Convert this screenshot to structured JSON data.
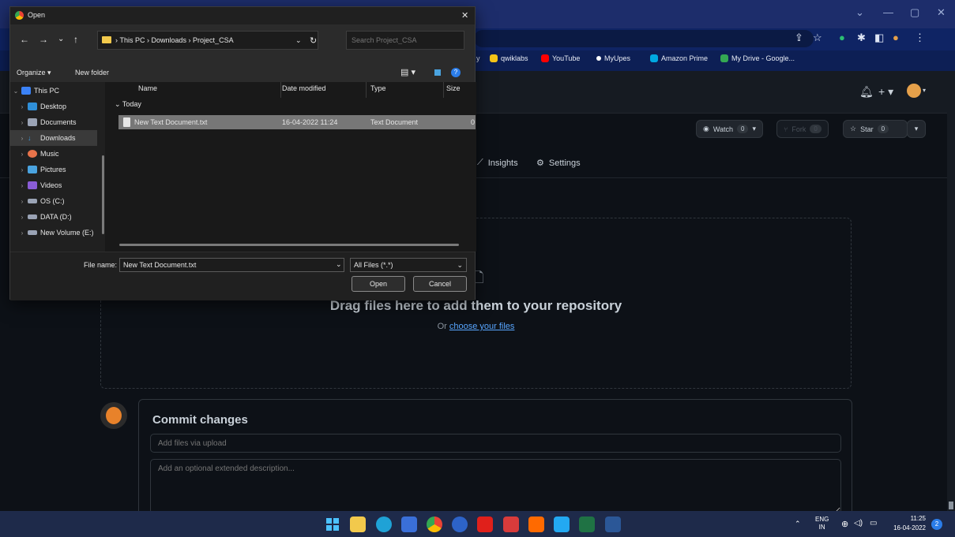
{
  "dialog": {
    "title": "Open",
    "close": "✕",
    "breadcrumb": [
      "This PC",
      "Downloads",
      "Project_CSA"
    ],
    "search_placeholder": "Search Project_CSA",
    "organize": "Organize ▾",
    "new_folder": "New folder",
    "nav_items": [
      {
        "label": "This PC",
        "color": "#3b82f6",
        "expanded": true
      },
      {
        "label": "Desktop",
        "color": "#2f8fd8"
      },
      {
        "label": "Documents",
        "color": "#9aa3b5"
      },
      {
        "label": "Downloads",
        "color": "#3b9ae1"
      },
      {
        "label": "Music",
        "color": "#e8734a"
      },
      {
        "label": "Pictures",
        "color": "#4aa3df"
      },
      {
        "label": "Videos",
        "color": "#8a5cd6"
      },
      {
        "label": "OS (C:)",
        "color": "#9aa3b5"
      },
      {
        "label": "DATA (D:)",
        "color": "#9aa3b5"
      },
      {
        "label": "New Volume (E:)",
        "color": "#9aa3b5"
      }
    ],
    "columns": {
      "name": "Name",
      "date": "Date modified",
      "type": "Type",
      "size": "Size"
    },
    "group": "Today",
    "file": {
      "name": "New Text Document.txt",
      "date": "16-04-2022 11:24",
      "type": "Text Document",
      "size": "0"
    },
    "file_name_label": "File name:",
    "file_name_value": "New Text Document.txt",
    "file_type": "All Files (*.*)",
    "open_button": "Open",
    "cancel_button": "Cancel"
  },
  "bookmarks": [
    {
      "label": "y",
      "color": "#000000"
    },
    {
      "label": "qwiklabs",
      "color": "#f5c518"
    },
    {
      "label": "YouTube",
      "color": "#ff0000"
    },
    {
      "label": "MyUpes",
      "color": "#ffffff"
    },
    {
      "label": "Amazon Prime",
      "color": "#00a8e1"
    },
    {
      "label": "My Drive - Google...",
      "color": "#34a853"
    }
  ],
  "repo": {
    "watch": "Watch",
    "watch_count": "0",
    "fork": "Fork",
    "fork_count": "0",
    "star": "Star",
    "star_count": "0",
    "tab_insights": "Insights",
    "tab_settings": "Settings"
  },
  "upload": {
    "drop_title": "Drag files here to add them to your repository",
    "drop_or": "Or",
    "drop_link": "choose your files",
    "commit_title": "Commit changes",
    "commit_placeholder": "Add files via upload",
    "commit_desc_placeholder": "Add an optional extended description..."
  },
  "tray": {
    "lang_top": "ENG",
    "lang_bottom": "IN",
    "time": "11:25",
    "date": "16-04-2022",
    "notif_count": "2"
  }
}
